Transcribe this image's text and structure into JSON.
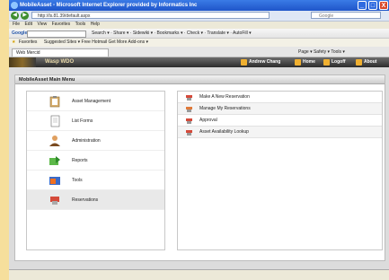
{
  "window": {
    "title": "MobileAsset - Microsoft Internet Explorer provided by Informatics Inc",
    "min": "_",
    "max": "□",
    "close": "X"
  },
  "address": {
    "url": "http://ls.81.39/default.aspx",
    "search_placeholder": "Google"
  },
  "menu": [
    "File",
    "Edit",
    "View",
    "Favorites",
    "Tools",
    "Help"
  ],
  "google_toolbar": {
    "label": "Google",
    "items": "Search ▾  · Share ▾  · Sidewiki ▾  · Bookmarks ▾  · Check ▾  · Translate ▾  · AutoFill ▾"
  },
  "favorites": {
    "label": "Favorites",
    "items": "Suggested Sites ▾   Free Hotmail   Get More Add-ons ▾"
  },
  "tab": {
    "label": "Web Mercid",
    "tools": "Page ▾  Safety ▾  Tools ▾"
  },
  "appbar": {
    "brand": "Wasp WDO",
    "links": [
      "Andrew Chang",
      "Home",
      "Logoff",
      "About"
    ]
  },
  "panel": {
    "title": "MobileAsset Main Menu"
  },
  "left_menu": [
    {
      "label": "Asset Management",
      "icon": "clipboard-icon"
    },
    {
      "label": "List Forms",
      "icon": "document-icon"
    },
    {
      "label": "Administration",
      "icon": "user-icon"
    },
    {
      "label": "Reports",
      "icon": "reports-icon"
    },
    {
      "label": "Tools",
      "icon": "tools-icon"
    },
    {
      "label": "Reservations",
      "icon": "reservations-icon"
    }
  ],
  "right_menu": [
    {
      "label": "Make A New Reservation"
    },
    {
      "label": "Manage My Reservations"
    },
    {
      "label": "Approval"
    },
    {
      "label": "Asset Availability Lookup"
    }
  ],
  "colors": {
    "titlebar": "#1f55c9",
    "appbar": "#2c2c2c",
    "accent": "#f0b030",
    "desktop": "#f6df9c"
  }
}
